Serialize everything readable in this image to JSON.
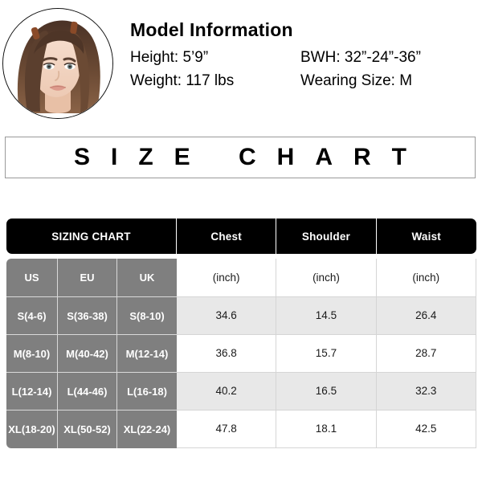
{
  "model": {
    "title": "Model Information",
    "photo_alt": "model-portrait",
    "height": "Height: 5’9”",
    "weight": "Weight: 117 lbs",
    "bwh": "BWH: 32”-24”-36”",
    "wearing_size": "Wearing Size: M"
  },
  "banner": {
    "text": "SIZE CHART"
  },
  "table": {
    "header": {
      "sizing_chart": "SIZING CHART",
      "measurements": [
        "Chest",
        "Shoulder",
        "Waist"
      ]
    },
    "sub_header": {
      "regions": [
        "US",
        "EU",
        "UK"
      ],
      "units": [
        "(inch)",
        "(inch)",
        "(inch)"
      ]
    },
    "rows": [
      {
        "us": "S(4-6)",
        "eu": "S(36-38)",
        "uk": "S(8-10)",
        "chest": "34.6",
        "shoulder": "14.5",
        "waist": "26.4"
      },
      {
        "us": "M(8-10)",
        "eu": "M(40-42)",
        "uk": "M(12-14)",
        "chest": "36.8",
        "shoulder": "15.7",
        "waist": "28.7"
      },
      {
        "us": "L(12-14)",
        "eu": "L(44-46)",
        "uk": "L(16-18)",
        "chest": "40.2",
        "shoulder": "16.5",
        "waist": "32.3"
      },
      {
        "us": "XL(18-20)",
        "eu": "XL(50-52)",
        "uk": "XL(22-24)",
        "chest": "47.8",
        "shoulder": "18.1",
        "waist": "42.5"
      }
    ]
  },
  "colors": {
    "header_bg": "#000000",
    "header_text": "#ffffff",
    "size_cell_bg": "#7f7f7f",
    "alt_row_bg": "#e8e8e8",
    "page_bg": "#ffffff",
    "banner_border": "#9a9a9a"
  }
}
